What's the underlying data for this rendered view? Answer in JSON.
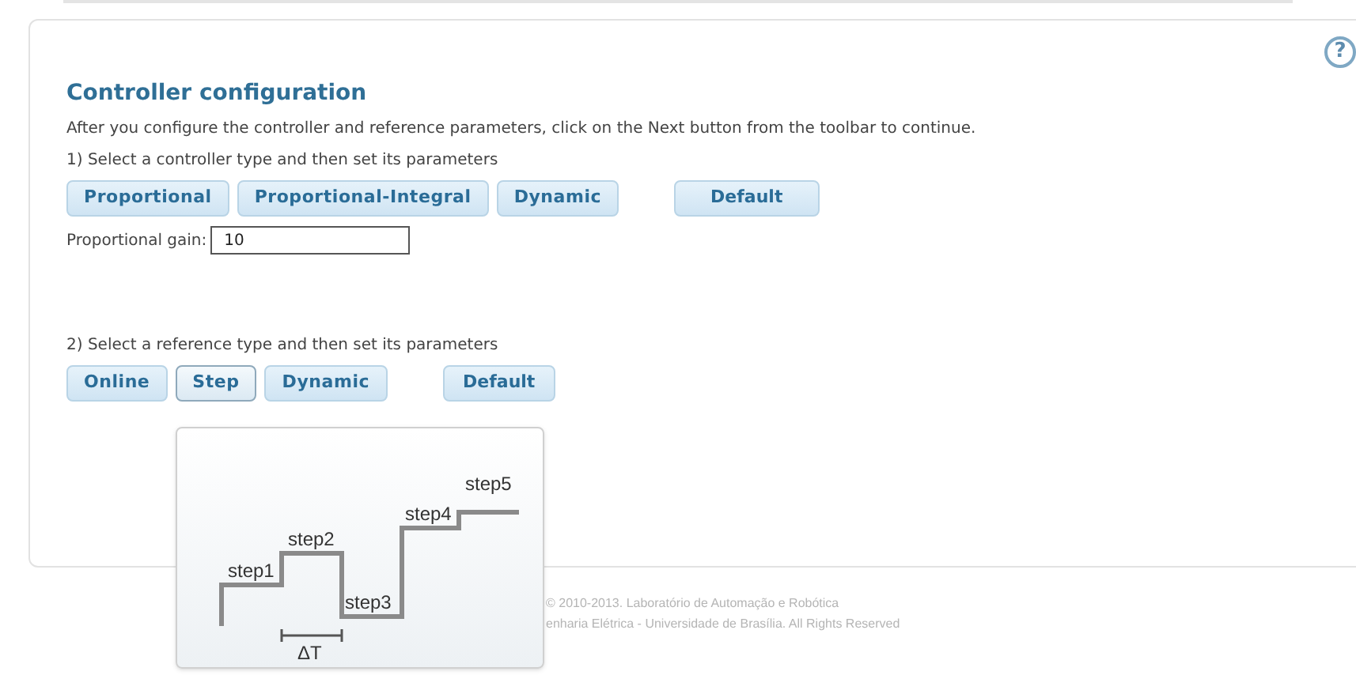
{
  "help": {
    "label": "?"
  },
  "title": "Controller configuration",
  "intro": "After you configure the controller and reference parameters, click on the Next button from the toolbar to continue.",
  "controller": {
    "instruction": "1) Select a controller type and then set its parameters",
    "types": [
      {
        "label": "Proportional",
        "selected": false
      },
      {
        "label": "Proportional-Integral",
        "selected": false
      },
      {
        "label": "Dynamic",
        "selected": false
      }
    ],
    "default_button": "Default",
    "gain": {
      "label": "Proportional gain:",
      "value": "10"
    }
  },
  "reference": {
    "instruction": "2) Select a reference type and then set its parameters",
    "types": [
      {
        "label": "Online",
        "selected": false
      },
      {
        "label": "Step",
        "selected": true
      },
      {
        "label": "Dynamic",
        "selected": false
      }
    ],
    "default_button": "Default"
  },
  "tooltip": {
    "steps": [
      "step1",
      "step2",
      "step3",
      "step4",
      "step5"
    ],
    "interval": "ΔT"
  },
  "footer": [
    "© 2010-2013. Laboratório de Automação e Robótica",
    "enharia Elétrica - Universidade de Brasília. All Rights Reserved"
  ]
}
